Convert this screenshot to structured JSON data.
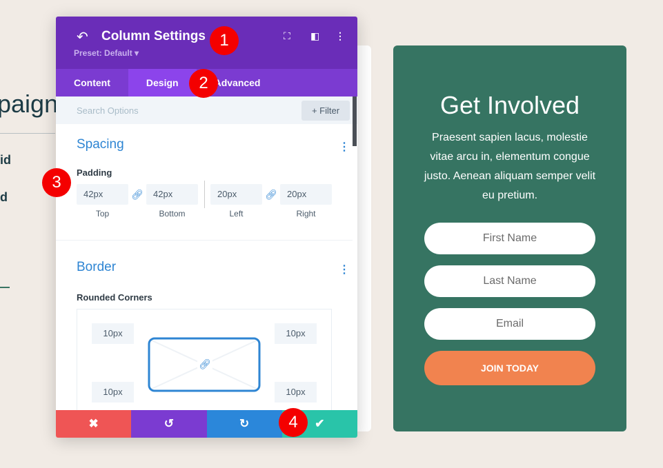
{
  "background": {
    "heading_fragment": "paigns",
    "text_fragments": [
      "id",
      "d"
    ]
  },
  "panel": {
    "title": "Column Settings",
    "preset": "Preset: Default ▾",
    "tabs": [
      "Content",
      "Design",
      "Advanced"
    ],
    "search_placeholder": "Search Options",
    "filter_label": "+ Filter",
    "spacing": {
      "title": "Spacing",
      "padding_label": "Padding",
      "fields": [
        {
          "value": "42px",
          "label": "Top"
        },
        {
          "value": "42px",
          "label": "Bottom"
        },
        {
          "value": "20px",
          "label": "Left"
        },
        {
          "value": "20px",
          "label": "Right"
        }
      ]
    },
    "border": {
      "title": "Border",
      "rounded_label": "Rounded Corners",
      "corners": [
        "10px",
        "10px",
        "10px",
        "10px"
      ]
    }
  },
  "badges": [
    "1",
    "2",
    "3",
    "4"
  ],
  "cta": {
    "title": "Get Involved",
    "text": "Praesent sapien lacus, molestie vitae arcu in, elementum congue justo. Aenean aliquam semper velit eu pretium.",
    "first_name": "First Name",
    "last_name": "Last Name",
    "email": "Email",
    "button": "JOIN TODAY"
  },
  "colors": {
    "header": "#6a2db8",
    "tabs": "#7b3bd1",
    "cancel": "#ef5555",
    "undo": "#7b3bd1",
    "redo": "#2b87da",
    "save": "#29c4a9",
    "cta_bg": "#367462",
    "cta_button": "#f1834f"
  }
}
